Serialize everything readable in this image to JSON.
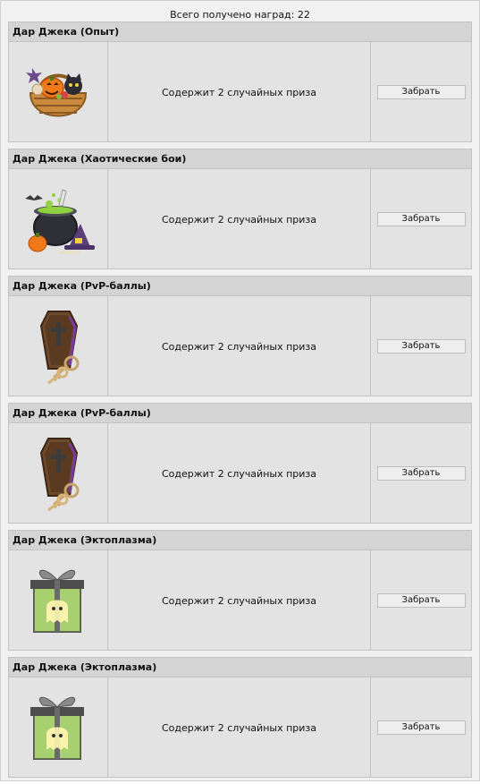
{
  "summary": {
    "total_rewards_text": "Всего получено наград: 22"
  },
  "gifts": [
    {
      "title": "Дар Джека (Опыт)",
      "description": "Содержит 2 случайных приза",
      "button_label": "Забрать",
      "icon": "pumpkin-basket-icon"
    },
    {
      "title": "Дар Джека (Хаотические бои)",
      "description": "Содержит 2 случайных приза",
      "button_label": "Забрать",
      "icon": "witch-cauldron-icon"
    },
    {
      "title": "Дар Джека (PvP-баллы)",
      "description": "Содержит 2 случайных приза",
      "button_label": "Забрать",
      "icon": "coffin-keys-icon"
    },
    {
      "title": "Дар Джека (PvP-баллы)",
      "description": "Содержит 2 случайных приза",
      "button_label": "Забрать",
      "icon": "coffin-keys-icon"
    },
    {
      "title": "Дар Джека (Эктоплазма)",
      "description": "Содержит 2 случайных приза",
      "button_label": "Забрать",
      "icon": "ghost-gift-box-icon"
    },
    {
      "title": "Дар Джека (Эктоплазма)",
      "description": "Содержит 2 случайных приза",
      "button_label": "Забрать",
      "icon": "ghost-gift-box-icon"
    }
  ]
}
